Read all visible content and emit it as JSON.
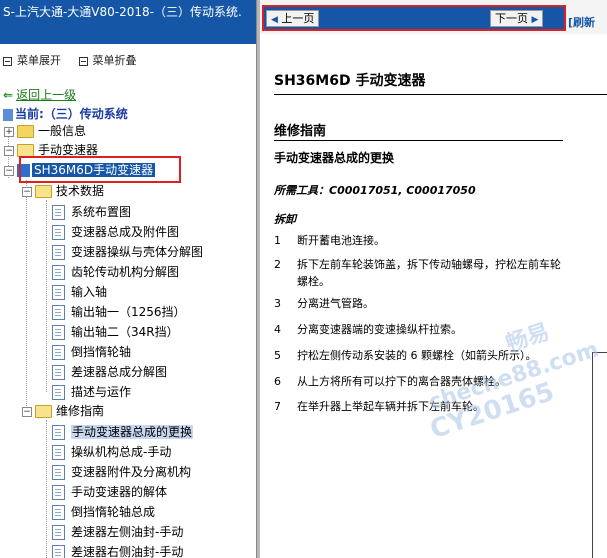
{
  "sidebar": {
    "title": "S-上汽大通-大通V80-2018-（三）传动系统.",
    "menu_expand": "菜单展开",
    "menu_collapse": "菜单折叠",
    "back_link": "返回上一级",
    "current_label": "当前:（三）传动系统",
    "tree": {
      "general": "一般信息",
      "manual_trans": "手动变速器",
      "selected": "SH36M6D手动变速器",
      "tech_data": "技术数据",
      "tech_items": [
        "系统布置图",
        "变速器总成及附件图",
        "变速器操纵与壳体分解图",
        "齿轮传动机构分解图",
        "输入轴",
        "输出轴一（1256挡）",
        "输出轴二（34R挡）",
        "倒挡惰轮轴",
        "差速器总成分解图",
        "描述与运作"
      ],
      "repair_guide": "维修指南",
      "repair_items": [
        "手动变速器总成的更换",
        "操纵机构总成-手动",
        "变速器附件及分离机构",
        "手动变速器的解体",
        "倒挡惰轮轴总成",
        "差速器左侧油封-手动",
        "差速器右侧油封-手动"
      ]
    }
  },
  "nav": {
    "prev": "上一页",
    "next": "下一页",
    "refresh": "[刷新"
  },
  "document": {
    "title": "SH36M6D 手动变速器",
    "section": "维修指南",
    "subsection": "手动变速器总成的更换",
    "tools": "所需工具：C00017051, C00017050",
    "removal": "拆卸",
    "steps": [
      {
        "n": "1",
        "t": "断开蓄电池连接。"
      },
      {
        "n": "2",
        "t": "拆下左前车轮装饰盖，拆下传动轴螺母，拧松左前车轮螺栓。"
      },
      {
        "n": "3",
        "t": "分离进气管路。"
      },
      {
        "n": "4",
        "t": "分离变速器端的变速操纵杆拉索。"
      },
      {
        "n": "5",
        "t": "拧松左侧传动系安装的 6 颗螺栓（如箭头所示）。"
      },
      {
        "n": "6",
        "t": "从上方将所有可以拧下的离合器壳体螺栓。"
      },
      {
        "n": "7",
        "t": "在举升器上举起车辆并拆下左前车轮。"
      }
    ]
  },
  "watermark": {
    "line1": "畅易",
    "line2": "cheche88.com",
    "line3": "CY20165"
  },
  "colors": {
    "title_bar": "#1557a6",
    "highlight_box": "#e02020",
    "link_green": "#1b7a1b"
  }
}
